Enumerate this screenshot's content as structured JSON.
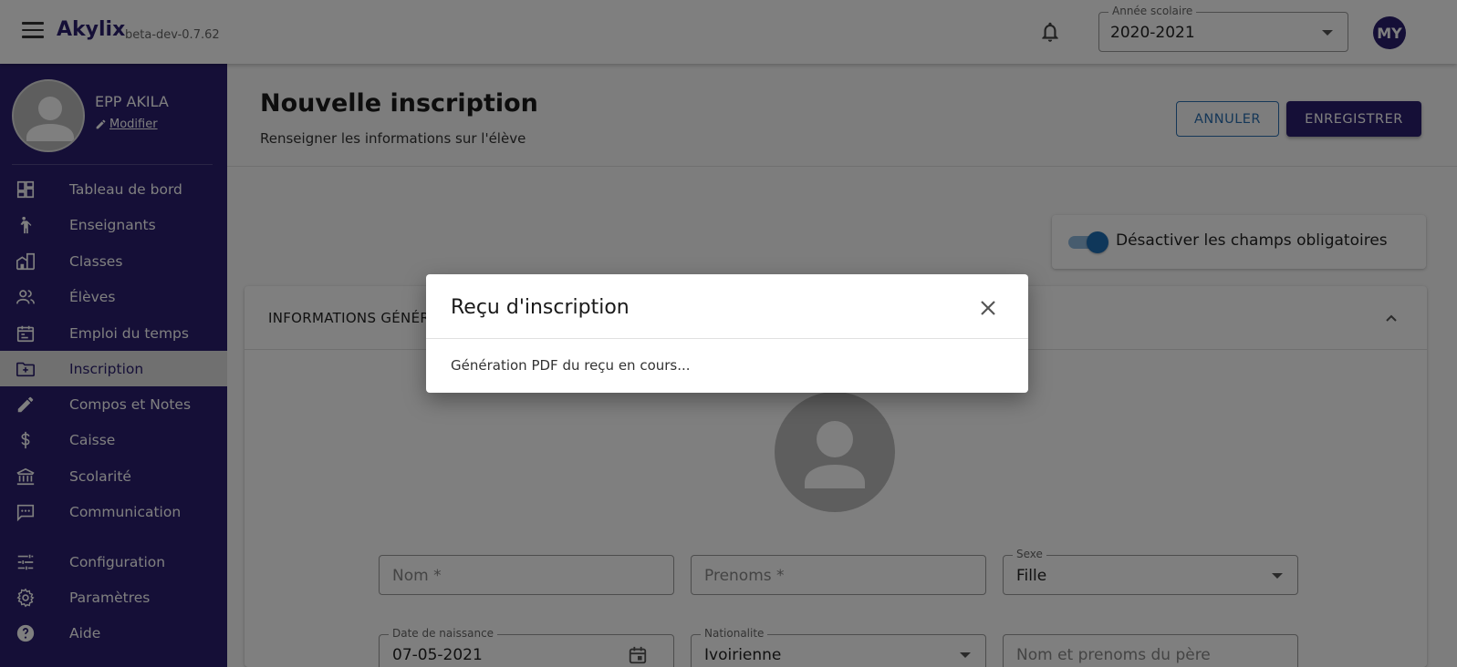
{
  "app": {
    "brand": "Akylix",
    "version": "beta-dev-0.7.62",
    "avatar_initials": "MY"
  },
  "year_select": {
    "label": "Année scolaire",
    "value": "2020-2021"
  },
  "profile": {
    "name": "EPP AKILA",
    "edit_label": "Modifier"
  },
  "sidebar": {
    "items": [
      {
        "label": "Tableau de bord",
        "icon": "dashboard-icon"
      },
      {
        "label": "Enseignants",
        "icon": "teacher-icon"
      },
      {
        "label": "Classes",
        "icon": "building-icon"
      },
      {
        "label": "Élèves",
        "icon": "people-icon"
      },
      {
        "label": "Emploi du temps",
        "icon": "calendar-icon"
      },
      {
        "label": "Inscription",
        "icon": "folder-add-icon",
        "active": true
      },
      {
        "label": "Compos et Notes",
        "icon": "pencil-icon"
      },
      {
        "label": "Caisse",
        "icon": "dollar-icon"
      },
      {
        "label": "Scolarité",
        "icon": "bank-icon"
      },
      {
        "label": "Communication",
        "icon": "chat-icon"
      },
      {
        "label": "Configuration",
        "icon": "sliders-icon"
      },
      {
        "label": "Paramètres",
        "icon": "gear-icon"
      },
      {
        "label": "Aide",
        "icon": "help-icon"
      }
    ]
  },
  "page": {
    "title": "Nouvelle inscription",
    "subtitle": "Renseigner les informations sur l'élève",
    "cancel_label": "ANNULER",
    "save_label": "ENREGISTRER"
  },
  "toggle": {
    "label": "Désactiver les champs obligatoires",
    "on": true
  },
  "section": {
    "title": "INFORMATIONS GÉNÉRALES"
  },
  "form": {
    "nom_placeholder": "Nom *",
    "prenoms_placeholder": "Prenoms *",
    "sexe_label": "Sexe",
    "sexe_value": "Fille",
    "dob_label": "Date de naissance",
    "dob_value": "07-05-2021",
    "nationalite_label": "Nationalite",
    "nationalite_value": "Ivoirienne",
    "pere_placeholder": "Nom et prenoms du père"
  },
  "dialog": {
    "title": "Reçu d'inscription",
    "body": "Génération PDF du reçu en cours..."
  },
  "colors": {
    "primary": "#2a1f6e",
    "accent": "#1f6fb5"
  }
}
